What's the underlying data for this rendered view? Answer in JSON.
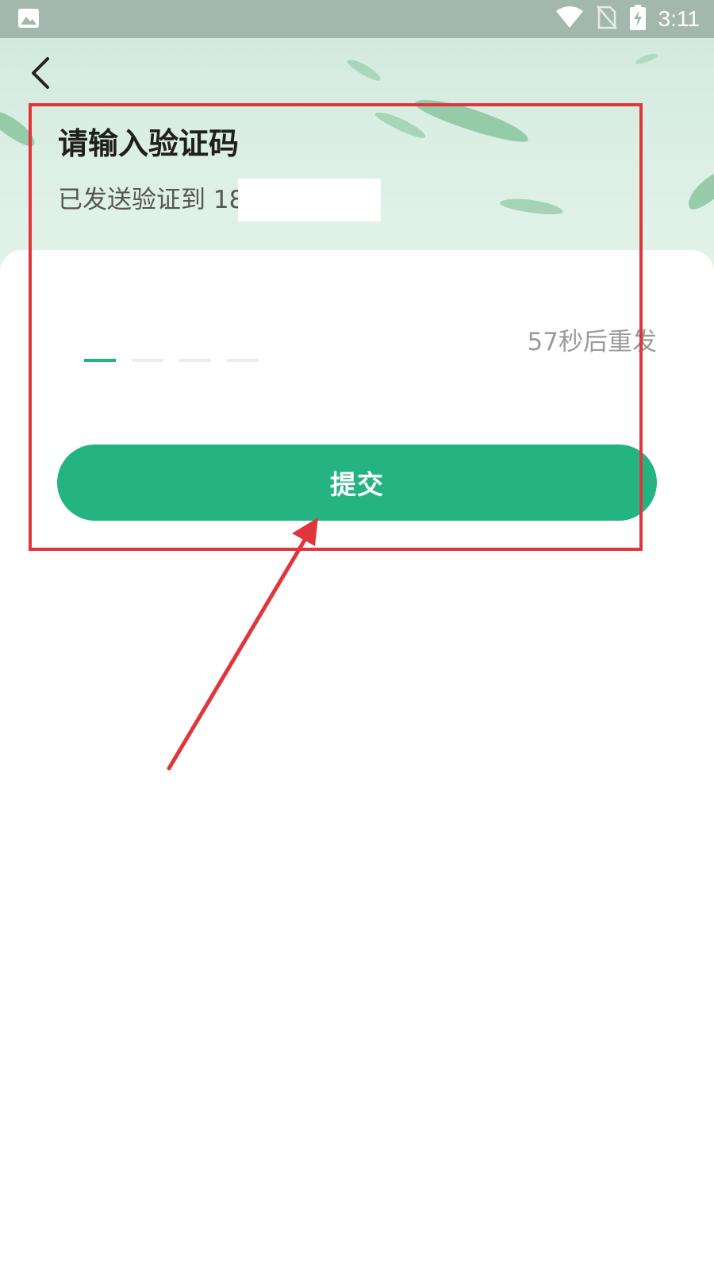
{
  "status_bar": {
    "time": "3:11",
    "icons": [
      "image-icon",
      "wifi-icon",
      "no-sim-icon",
      "battery-charging-icon"
    ]
  },
  "header": {
    "back_icon": "chevron-left-icon",
    "title": "请输入验证码",
    "sent_hint": "已发送验证到 18"
  },
  "verification": {
    "slot_count": 4,
    "active_slot": 1,
    "resend_text": "57秒后重发"
  },
  "actions": {
    "submit_label": "提交"
  },
  "colors": {
    "accent": "#24b482",
    "annotation": "#e0363b",
    "status_bar": "#a3b8ad"
  }
}
